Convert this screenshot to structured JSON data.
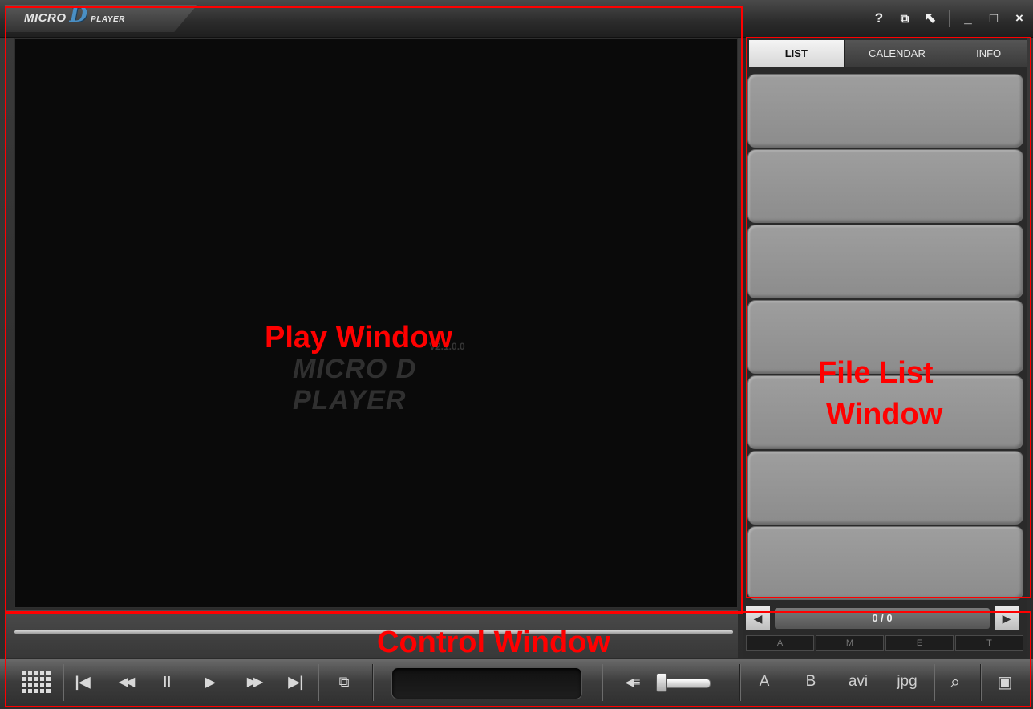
{
  "app": {
    "logo_micro": "MICRO",
    "logo_d": "D",
    "logo_player": "PLAYER"
  },
  "titlebar": {
    "icons": [
      "help-icon",
      "snapshot-settings-icon",
      "tools-icon",
      "minimize-icon",
      "maximize-icon",
      "close-icon"
    ],
    "help_glyph": "?",
    "snap_glyph": "⧉",
    "tools_glyph": "⬉",
    "min_glyph": "_",
    "max_glyph": "□",
    "close_glyph": "×"
  },
  "play_window": {
    "watermark_main": "MICRO D PLAYER",
    "watermark_version": "V2.1.0.0"
  },
  "file_panel": {
    "tabs": [
      {
        "label": "LIST",
        "active": true
      },
      {
        "label": "CALENDAR",
        "active": false
      },
      {
        "label": "INFO",
        "active": false
      }
    ],
    "list_slot_count": 7,
    "pager_text": "0 / 0",
    "prev_glyph": "◀",
    "next_glyph": "▶",
    "filters": [
      "A",
      "M",
      "E",
      "T"
    ]
  },
  "controls": {
    "prev_file_glyph": "|◀",
    "rewind_glyph": "◀◀",
    "pause_glyph": "II",
    "play_glyph": "▶",
    "forward_glyph": "▶▶",
    "next_file_glyph": "▶|",
    "split_glyph": "⧉",
    "volume_glyph": "◀≡",
    "volume_level": 0.0,
    "btn_a": "A",
    "btn_b": "B",
    "btn_avi": "avi",
    "btn_jpg": "jpg",
    "search_glyph": "⌕",
    "folder_glyph": "▣"
  },
  "annotations": {
    "play_window": "Play Window",
    "file_list_line1": "File List",
    "file_list_line2": "Window",
    "control_window": "Control Window"
  },
  "colors": {
    "annotation": "#ff0000",
    "logo_accent": "#4a8fc4",
    "list_slot": "#9a9a9a"
  }
}
